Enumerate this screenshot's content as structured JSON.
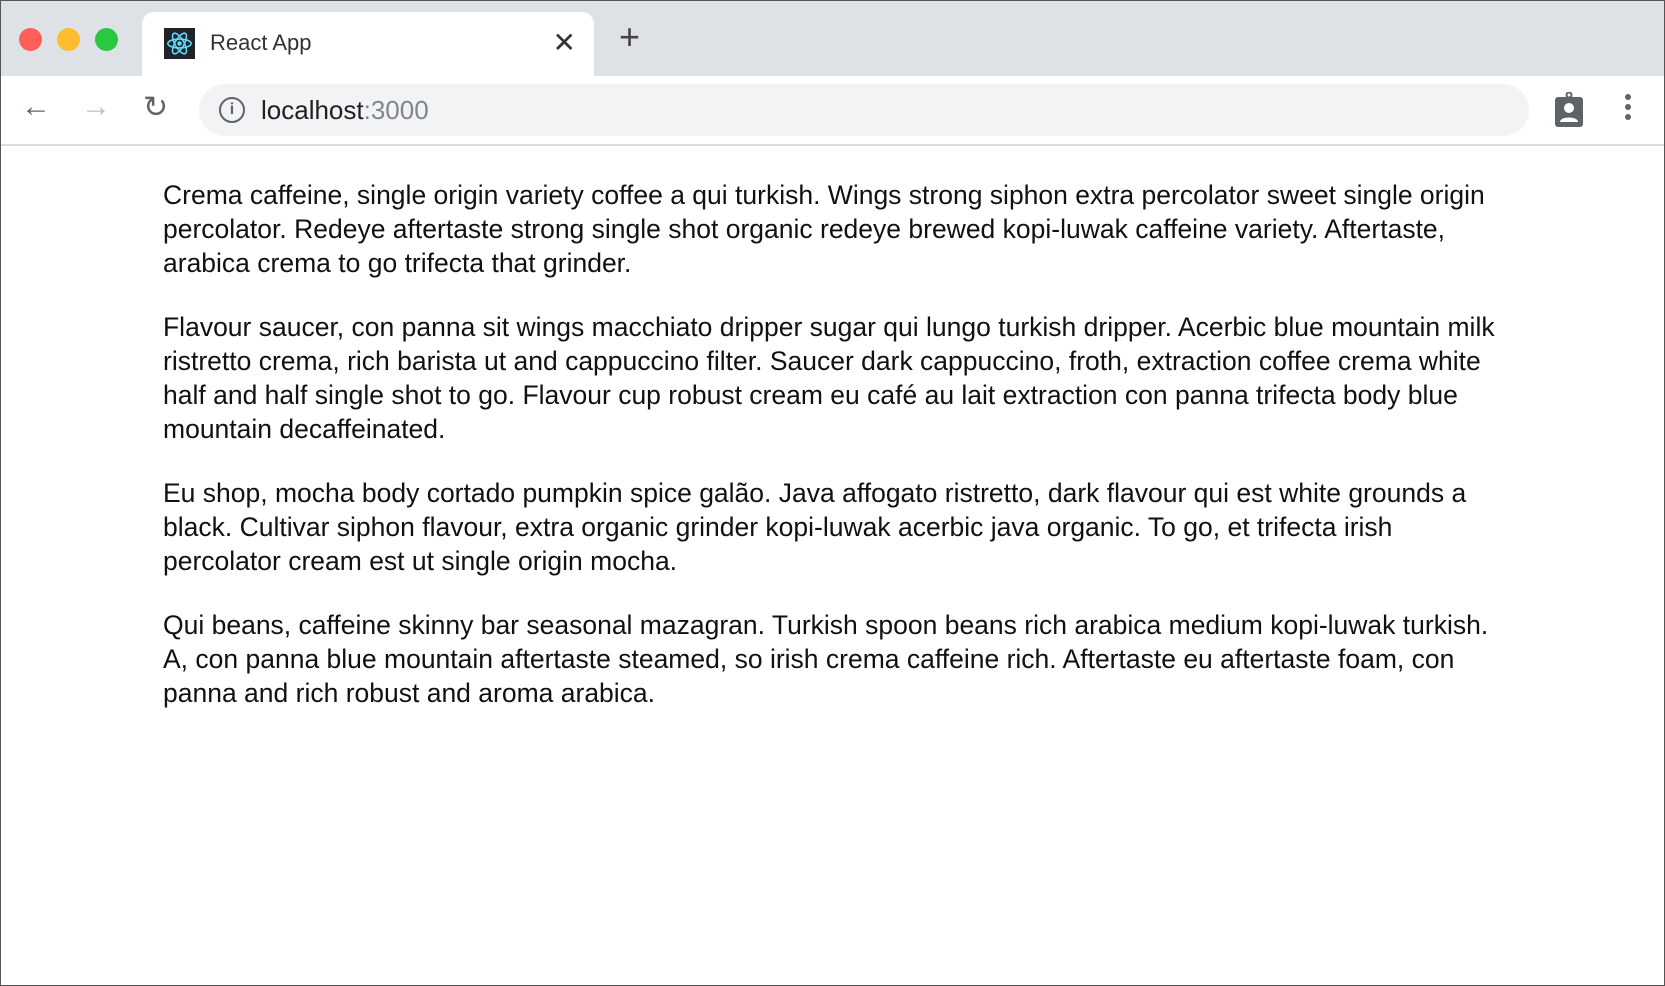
{
  "browser": {
    "tab_title": "React App",
    "tab_icon": "react-logo-icon",
    "url_host": "localhost",
    "url_port": ":3000",
    "colors": {
      "close": "#ff5f57",
      "minimize": "#febc2e",
      "maximize": "#28c840",
      "react": "#61dafb"
    }
  },
  "content": {
    "paragraphs": [
      "Crema caffeine, single origin variety coffee a qui turkish. Wings strong siphon extra percolator sweet single origin percolator. Redeye aftertaste strong single shot organic redeye brewed kopi-luwak caffeine variety. Aftertaste, arabica crema to go trifecta that grinder.",
      "Flavour saucer, con panna sit wings macchiato dripper sugar qui lungo turkish dripper. Acerbic blue mountain milk ristretto crema, rich barista ut and cappuccino filter. Saucer dark cappuccino, froth, extraction coffee crema white half and half single shot to go. Flavour cup robust cream eu café au lait extraction con panna trifecta body blue mountain decaffeinated.",
      "Eu shop, mocha body cortado pumpkin spice galão. Java affogato ristretto, dark flavour qui est white grounds a black. Cultivar siphon flavour, extra organic grinder kopi-luwak acerbic java organic. To go, et trifecta irish percolator cream est ut single origin mocha.",
      "Qui beans, caffeine skinny bar seasonal mazagran. Turkish spoon beans rich arabica medium kopi-luwak turkish. A, con panna blue mountain aftertaste steamed, so irish crema caffeine rich. Aftertaste eu aftertaste foam, con panna and rich robust and aroma arabica."
    ]
  }
}
